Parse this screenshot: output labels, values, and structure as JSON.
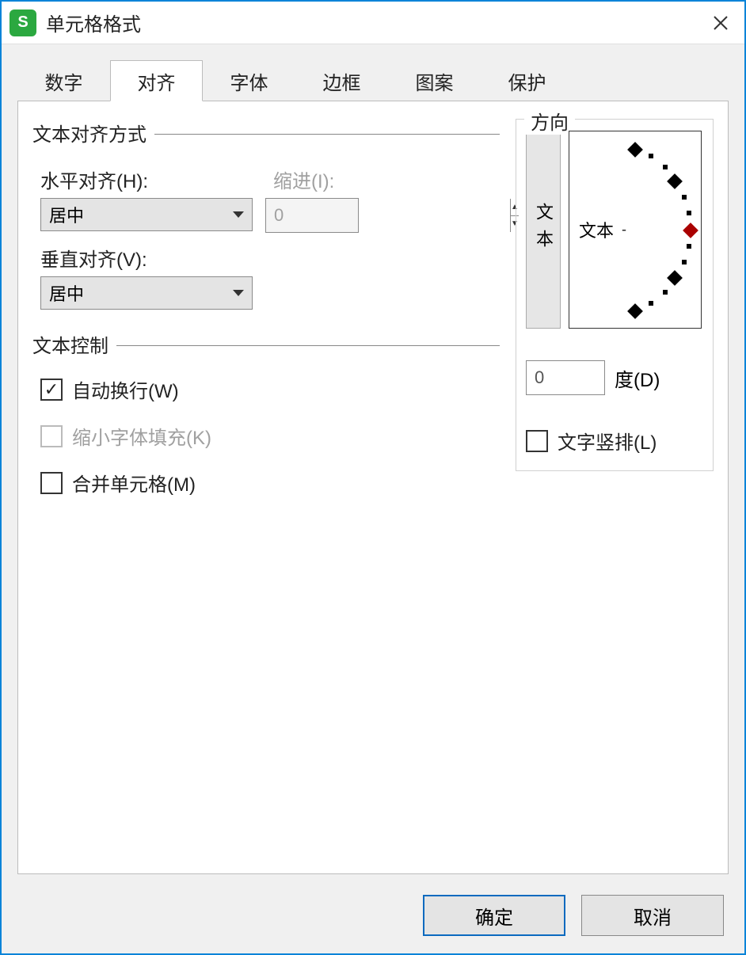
{
  "window": {
    "title": "单元格格式"
  },
  "tabs": [
    "数字",
    "对齐",
    "字体",
    "边框",
    "图案",
    "保护"
  ],
  "active_tab_index": 1,
  "align": {
    "group_title": "文本对齐方式",
    "horizontal_label": "水平对齐(H):",
    "horizontal_value": "居中",
    "indent_label": "缩进(I):",
    "indent_value": "0",
    "vertical_label": "垂直对齐(V):",
    "vertical_value": "居中"
  },
  "control": {
    "group_title": "文本控制",
    "wrap": {
      "label": "自动换行(W)",
      "checked": true
    },
    "shrink": {
      "label": "缩小字体填充(K)",
      "checked": false,
      "disabled": true
    },
    "merge": {
      "label": "合并单元格(M)",
      "checked": false
    }
  },
  "orientation": {
    "group_title": "方向",
    "vertical_button": "文本",
    "dial_text": "文本",
    "degree_value": "0",
    "degree_label": "度(D)",
    "vertical_text": {
      "label": "文字竖排(L)",
      "checked": false
    }
  },
  "buttons": {
    "ok": "确定",
    "cancel": "取消"
  }
}
